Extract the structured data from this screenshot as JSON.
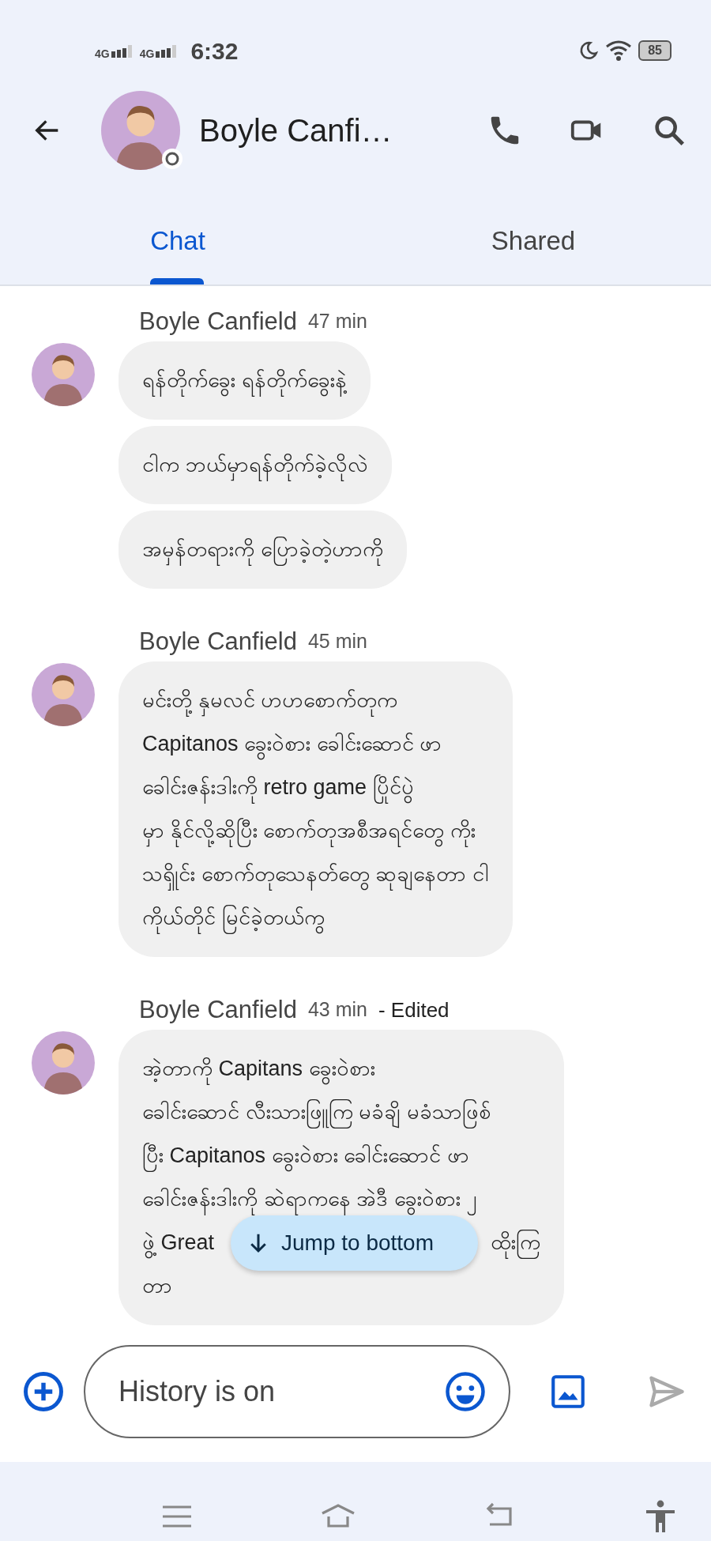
{
  "status_bar": {
    "signals": [
      "4G",
      "4G"
    ],
    "time": "6:32",
    "battery": "85"
  },
  "header": {
    "title": "Boyle Canfi…"
  },
  "tabs": [
    {
      "label": "Chat",
      "selected": true
    },
    {
      "label": "Shared",
      "selected": false
    }
  ],
  "messages": [
    {
      "sender": "Boyle Canfield",
      "time": "47 min",
      "bubbles": [
        {
          "lines": [
            [
              "ရန်တိုက်ခွေး ရန်တိုက်ခွေးနဲ့"
            ]
          ]
        },
        {
          "lines": [
            [
              "ငါက ဘယ်မှာရန်တိုက်ခဲ့လိုလဲ"
            ]
          ]
        },
        {
          "lines": [
            [
              "အမှန်တရားကို ပြောခဲ့တဲ့ဟာကို"
            ]
          ]
        }
      ]
    },
    {
      "sender": "Boyle Canfield",
      "time": "45 min",
      "bubbles": [
        {
          "lines": [
            [
              "မင်းတို့ နှမလင် ဟဟစောက်တုက"
            ],
            [
              "Capitanos ခွေးဝဲစား ခေါင်းဆောင် ဖာ"
            ],
            [
              "ခေါင်းဇန်းဒါးကို retro game ပြိုင်ပွဲ"
            ],
            [
              "မှာ နိုင်လို့ဆိုပြီး စောက်တုအစီအရင်တွေ ကိုး"
            ],
            [
              "သၡိုင်း စောက်တုသေနတ်တွေ ဆုချနေတာ ငါ"
            ],
            [
              "ကိုယ်တိုင် မြင်ခဲ့တယ်ကွ"
            ]
          ]
        }
      ]
    },
    {
      "sender": "Boyle Canfield",
      "time": "43 min",
      "note": "- Edited",
      "bubbles": [
        {
          "lines": [
            [
              "အဲ့တာကို Capitans ခွေးဝဲစား"
            ],
            [
              "ခေါင်းဆောင် လီးသားဖြူကြ မခံချိ မခံသာဖြစ်"
            ],
            [
              "ပြီး Capitanos ခွေးဝဲစား ခေါင်းဆောင် ဖာ"
            ],
            [
              "ခေါင်းဇန်းဒါးကို ဆဲရာကနေ အဲဒီ ခွေးဝဲစား ၂"
            ],
            [
              "ဖွဲ့ Great",
              "ထိုးကြ"
            ],
            [
              "တာ"
            ]
          ]
        }
      ]
    }
  ],
  "jump_button": {
    "label": "Jump to bottom"
  },
  "composer": {
    "placeholder": "History is on"
  }
}
